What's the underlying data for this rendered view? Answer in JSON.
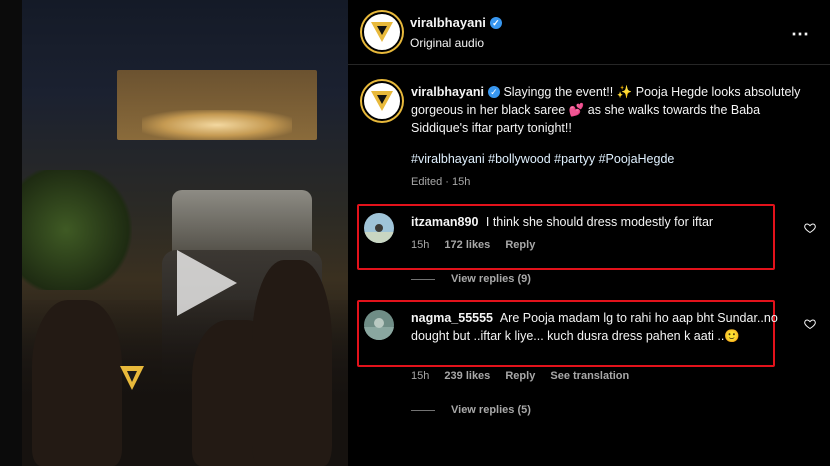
{
  "post": {
    "username": "viralbhayani",
    "audio": "Original audio",
    "more_icon": "⋯"
  },
  "caption": {
    "username": "viralbhayani",
    "text": "Slayingg the event!! ✨ Pooja Hegde looks absolutely gorgeous in her black saree 💕 as she walks towards the Baba Siddique's iftar party tonight!!",
    "hashtags": "#viralbhayani #bollywood #partyy #PoojaHegde",
    "edited": "Edited · 15h"
  },
  "comments": [
    {
      "username": "itzaman890",
      "text": "I think she should dress modestly for iftar",
      "time": "15h",
      "likes": "172 likes",
      "reply": "Reply",
      "view_replies": "View replies (9)"
    },
    {
      "username": "nagma_55555",
      "text": "Are Pooja madam lg to rahi ho aap bht Sundar..no dought but ..iftar k liye... kuch dusra dress pahen k aati ..🙂",
      "time": "15h",
      "likes": "239 likes",
      "reply": "Reply",
      "translate": "See translation",
      "view_replies": "View replies (5)"
    }
  ],
  "colors": {
    "highlight": "#e3121b",
    "verified": "#3897f0",
    "ring": "#e8b93b"
  },
  "icons": {
    "play": "play-icon",
    "heart": "heart-icon",
    "verified": "verified-badge-icon",
    "more": "more-options-icon"
  }
}
